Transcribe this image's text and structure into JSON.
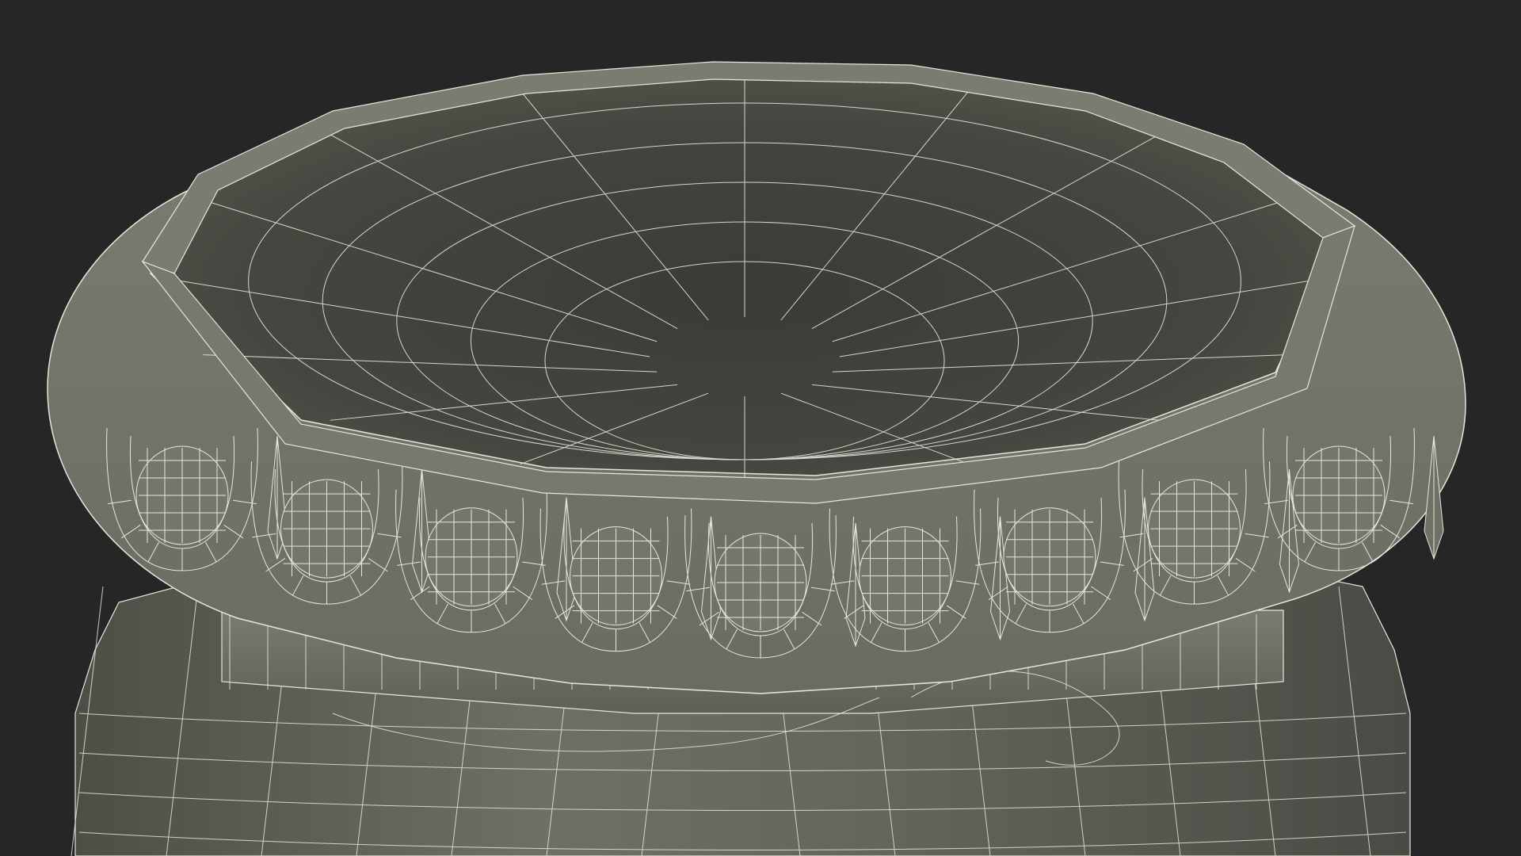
{
  "scene": {
    "subject": "wireframe-vase-rim",
    "background_color": "#262626",
    "mesh_fill_color": "#6b6b62",
    "mesh_shadow_color": "#3e3f3a",
    "mesh_highlight_color": "#8a8a80",
    "wire_color": "#e6e6dc"
  }
}
